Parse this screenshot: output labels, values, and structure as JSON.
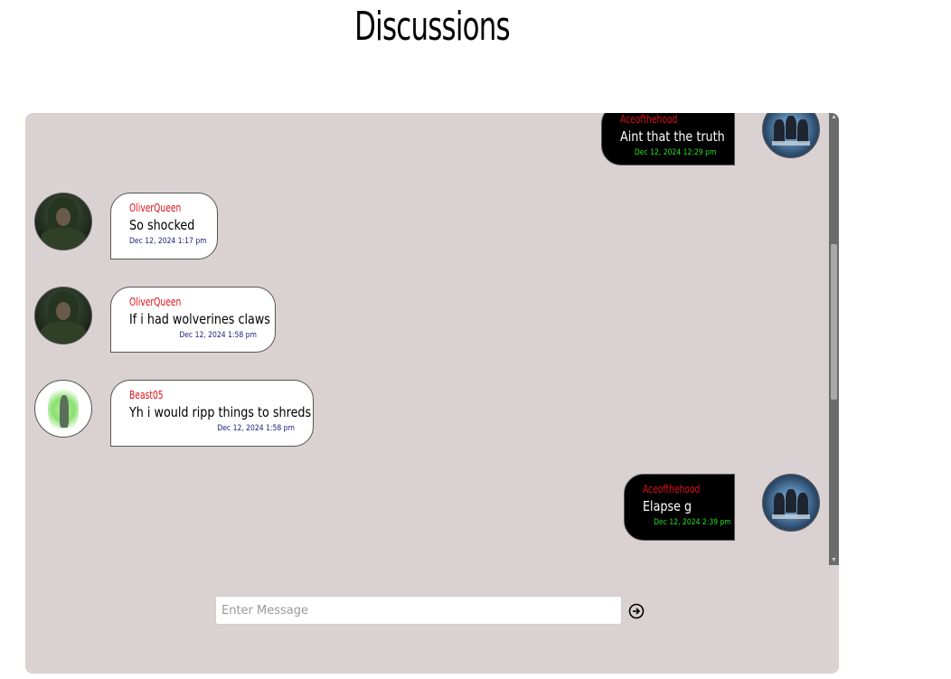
{
  "page": {
    "title": "Discussions"
  },
  "messages": [
    {
      "author": "Aceofthehood",
      "text": "Aint that the truth",
      "time": "Dec 12, 2024 12:29 pm",
      "side": "right",
      "avatar": "panther-poster-avatar"
    },
    {
      "author": "OliverQueen",
      "text": "So shocked",
      "time": "Dec 12, 2024 1:17 pm",
      "side": "left",
      "avatar": "hooded-archer-avatar"
    },
    {
      "author": "OliverQueen",
      "text": "If i had wolverines claws",
      "time": "Dec 12, 2024 1:58 pm",
      "side": "left",
      "avatar": "hooded-archer-avatar"
    },
    {
      "author": "Beast05",
      "text": "Yh i would ripp things to shreds",
      "time": "Dec 12, 2024 1:58 pm",
      "side": "left",
      "avatar": "green-glow-avatar"
    },
    {
      "author": "Aceofthehood",
      "text": "Elapse g",
      "time": "Dec 12, 2024 2:39 pm",
      "side": "right",
      "avatar": "panther-poster-avatar"
    }
  ],
  "composer": {
    "placeholder": "Enter Message",
    "value": "",
    "send_icon": "arrow-circle-right-icon"
  },
  "colors": {
    "panel_background": "#d9d1d2",
    "author_name": "#e0101a",
    "left_timestamp": "#1a1a80",
    "right_timestamp": "#22e022",
    "right_bubble": "#000000",
    "left_bubble": "#ffffff"
  }
}
